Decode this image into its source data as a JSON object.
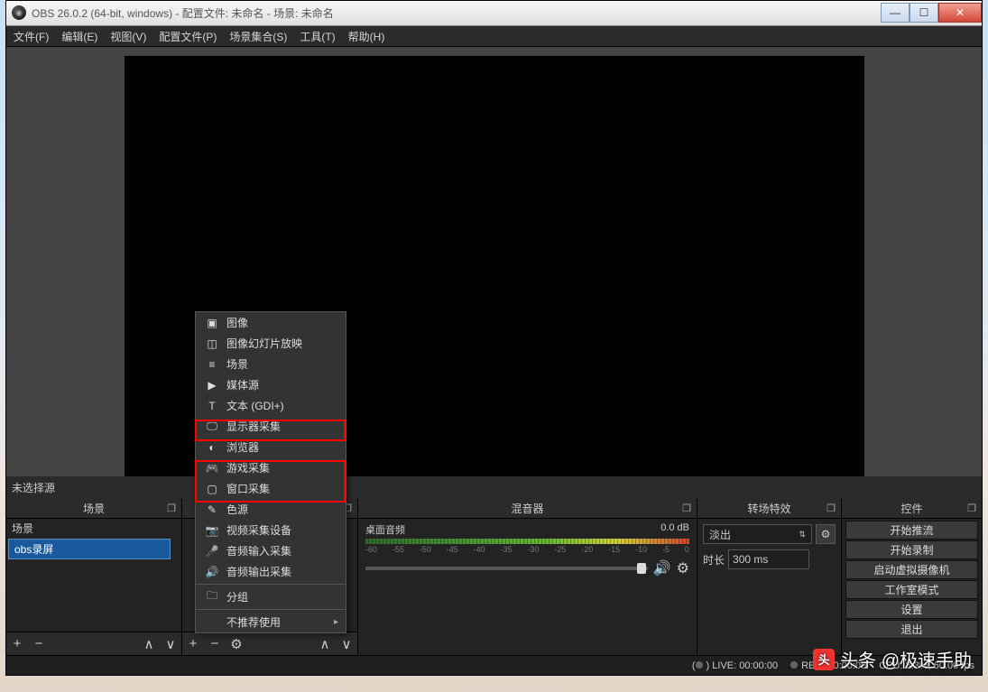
{
  "window_title": "OBS 26.0.2 (64-bit, windows) - 配置文件: 未命名 - 场景: 未命名",
  "menubar": [
    "文件(F)",
    "编辑(E)",
    "视图(V)",
    "配置文件(P)",
    "场景集合(S)",
    "工具(T)",
    "帮助(H)"
  ],
  "panels": {
    "scenes": {
      "title": "场景",
      "static": "场景",
      "selected": "obs录屏"
    },
    "sources": {
      "title": "",
      "no_source_label": "未选择源"
    },
    "mixer": {
      "title": "混音器",
      "channel": "桌面音频",
      "level": "0.0 dB",
      "ticks": [
        "-60",
        "-55",
        "-50",
        "-45",
        "-40",
        "-35",
        "-30",
        "-25",
        "-20",
        "-15",
        "-10",
        "-5",
        "0"
      ]
    },
    "transitions": {
      "title": "转场特效",
      "mode": "淡出",
      "duration_label": "时长",
      "duration": "300 ms"
    },
    "controls": {
      "title": "控件",
      "buttons": [
        "开始推流",
        "开始录制",
        "启动虚拟摄像机",
        "工作室模式",
        "设置",
        "退出"
      ]
    }
  },
  "context_menu": [
    {
      "icon": "▣",
      "label": "图像"
    },
    {
      "icon": "◫",
      "label": "图像幻灯片放映"
    },
    {
      "icon": "≡",
      "label": "场景"
    },
    {
      "icon": "▶",
      "label": "媒体源"
    },
    {
      "icon": "T",
      "label": "文本 (GDI+)"
    },
    {
      "icon": "🖵",
      "label": "显示器采集"
    },
    {
      "icon": "◐",
      "label": "浏览器"
    },
    {
      "icon": "🎮",
      "label": "游戏采集"
    },
    {
      "icon": "▢",
      "label": "窗口采集"
    },
    {
      "icon": "✎",
      "label": "色源"
    },
    {
      "icon": "📷",
      "label": "视频采集设备"
    },
    {
      "icon": "🎤",
      "label": "音频输入采集"
    },
    {
      "icon": "🔊",
      "label": "音频输出采集"
    },
    {
      "sep": true
    },
    {
      "icon": "🗀",
      "label": "分组"
    },
    {
      "sep": true
    },
    {
      "icon": "",
      "label": "不推荐使用",
      "sub": true
    }
  ],
  "statusbar": {
    "live": "LIVE: 00:00:00",
    "rec": "REC: 00:00:00",
    "cpu": "CPU: 8.3%, 60.00 fps"
  },
  "watermark": "头条 @极速手助"
}
